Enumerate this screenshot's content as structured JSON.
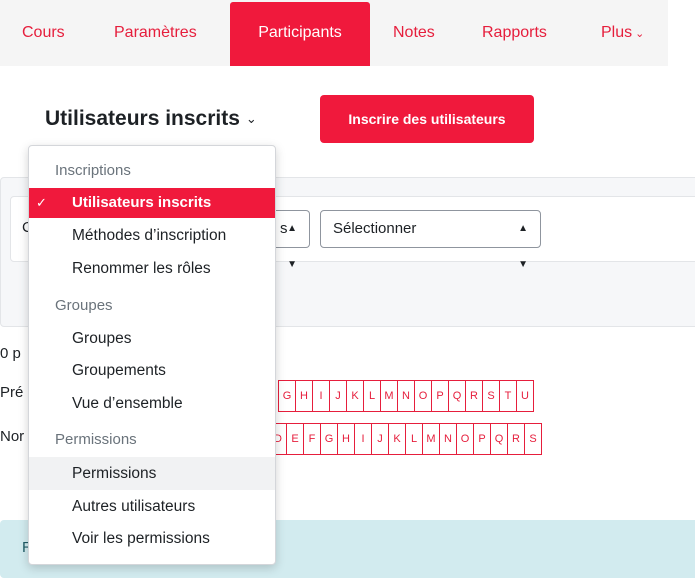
{
  "nav": {
    "items": [
      {
        "label": "Cours"
      },
      {
        "label": "Paramètres"
      },
      {
        "label": "Participants"
      },
      {
        "label": "Notes"
      },
      {
        "label": "Rapports"
      },
      {
        "label": "Plus"
      }
    ],
    "active": "Participants",
    "more_icon": "chevron-down-icon"
  },
  "header": {
    "title": "Utilisateurs inscrits",
    "title_icon": "chevron-down-icon",
    "enrol_button": "Inscrire des utilisateurs"
  },
  "filters": {
    "match_partial": "C",
    "partial_select_tail": "s",
    "type_select": "Sélectionner",
    "select_icon": "updown-arrows-icon"
  },
  "participants": {
    "count_partial": "0 p",
    "firstname_partial": "Pré",
    "lastname_partial": "Nor",
    "firstname_letters": [
      "G",
      "H",
      "I",
      "J",
      "K",
      "L",
      "M",
      "N",
      "O",
      "P",
      "Q",
      "R",
      "S",
      "T",
      "U"
    ],
    "lastname_letters": [
      "D",
      "E",
      "F",
      "G",
      "H",
      "I",
      "J",
      "K",
      "L",
      "M",
      "N",
      "O",
      "P",
      "Q",
      "R",
      "S"
    ]
  },
  "info": {
    "partial_text": "R"
  },
  "dropdown": {
    "sections": [
      {
        "header": "Inscriptions",
        "items": [
          "Utilisateurs inscrits",
          "Méthodes d’inscription",
          "Renommer les rôles"
        ]
      },
      {
        "header": "Groupes",
        "items": [
          "Groupes",
          "Groupements",
          "Vue d’ensemble"
        ]
      },
      {
        "header": "Permissions",
        "items": [
          "Permissions",
          "Autres utilisateurs",
          "Voir les permissions"
        ]
      }
    ],
    "selected": "Utilisateurs inscrits",
    "hovered": "Permissions",
    "check_icon": "check-icon"
  },
  "colors": {
    "accent": "#f0193c",
    "accent_text": "#e61e3c",
    "info_bg": "#d2ebef",
    "nav_bg": "#f5f5f5"
  }
}
